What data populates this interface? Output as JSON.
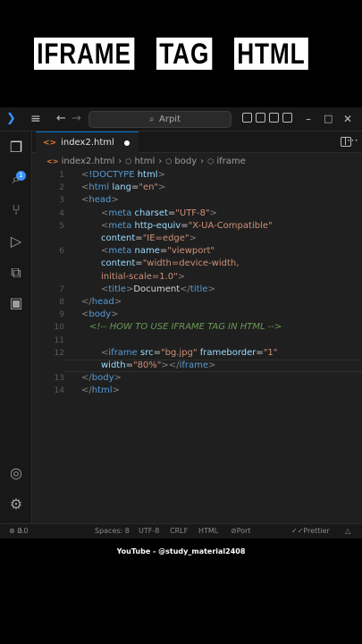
{
  "headline": {
    "words": [
      "IFRAME",
      "TAG",
      "HTML"
    ]
  },
  "titlebar": {
    "search_text": "Arpit"
  },
  "tab": {
    "label": "index2.html"
  },
  "breadcrumb": [
    "index2.html",
    "html",
    "body",
    "iframe"
  ],
  "code": {
    "lines": [
      {
        "n": "1",
        "segs": [
          [
            "b",
            "<"
          ],
          [
            "t",
            "!DOCTYPE"
          ],
          [
            "x",
            " "
          ],
          [
            "a",
            "html"
          ],
          [
            "b",
            ">"
          ]
        ]
      },
      {
        "n": "2",
        "segs": [
          [
            "b",
            "<"
          ],
          [
            "t",
            "html"
          ],
          [
            "x",
            " "
          ],
          [
            "a",
            "lang"
          ],
          [
            "x",
            "="
          ],
          [
            "s",
            "\"en\""
          ],
          [
            "b",
            ">"
          ]
        ]
      },
      {
        "n": "3",
        "segs": [
          [
            "b",
            "<"
          ],
          [
            "t",
            "head"
          ],
          [
            "b",
            ">"
          ]
        ]
      },
      {
        "n": "4",
        "segs": [
          [
            "b",
            "<"
          ],
          [
            "t",
            "meta"
          ],
          [
            "x",
            " "
          ],
          [
            "a",
            "charset"
          ],
          [
            "x",
            "="
          ],
          [
            "s",
            "\"UTF-8\""
          ],
          [
            "b",
            ">"
          ]
        ]
      },
      {
        "n": "5",
        "segs": [
          [
            "b",
            "<"
          ],
          [
            "t",
            "meta"
          ],
          [
            "x",
            " "
          ],
          [
            "a",
            "http-equiv"
          ],
          [
            "x",
            "="
          ],
          [
            "s",
            "\"X-UA-Compatible\""
          ]
        ]
      },
      {
        "n": "",
        "segs": [
          [
            "a",
            "content"
          ],
          [
            "x",
            "="
          ],
          [
            "s",
            "\"IE=edge\""
          ],
          [
            "b",
            ">"
          ]
        ]
      },
      {
        "n": "6",
        "segs": [
          [
            "b",
            "<"
          ],
          [
            "t",
            "meta"
          ],
          [
            "x",
            " "
          ],
          [
            "a",
            "name"
          ],
          [
            "x",
            "="
          ],
          [
            "s",
            "\"viewport\""
          ]
        ]
      },
      {
        "n": "",
        "segs": [
          [
            "a",
            "content"
          ],
          [
            "x",
            "="
          ],
          [
            "s",
            "\"width=device-width,"
          ]
        ]
      },
      {
        "n": "",
        "segs": [
          [
            "s",
            "initial-scale=1.0\""
          ],
          [
            "b",
            ">"
          ]
        ]
      },
      {
        "n": "7",
        "segs": [
          [
            "b",
            "<"
          ],
          [
            "t",
            "title"
          ],
          [
            "b",
            ">"
          ],
          [
            "x",
            "Document"
          ],
          [
            "b",
            "</"
          ],
          [
            "t",
            "title"
          ],
          [
            "b",
            ">"
          ]
        ]
      },
      {
        "n": "8",
        "segs": [
          [
            "b",
            "</"
          ],
          [
            "t",
            "head"
          ],
          [
            "b",
            ">"
          ]
        ]
      },
      {
        "n": "9",
        "segs": [
          [
            "b",
            "<"
          ],
          [
            "t",
            "body"
          ],
          [
            "b",
            ">"
          ]
        ]
      },
      {
        "n": "10",
        "segs": [
          [
            "c",
            "<!-- HOW TO USE IFRAME TAG IN HTML -->"
          ]
        ]
      },
      {
        "n": "11",
        "segs": []
      },
      {
        "n": "12",
        "segs": [
          [
            "b",
            "<"
          ],
          [
            "t",
            "iframe"
          ],
          [
            "x",
            " "
          ],
          [
            "a",
            "src"
          ],
          [
            "x",
            "="
          ],
          [
            "s",
            "\"bg.jpg\""
          ],
          [
            "x",
            " "
          ],
          [
            "a",
            "frameborder"
          ],
          [
            "x",
            "="
          ],
          [
            "s",
            "\"1\""
          ]
        ]
      },
      {
        "n": "",
        "segs": [
          [
            "a",
            "width"
          ],
          [
            "x",
            "="
          ],
          [
            "s",
            "\"80%\""
          ],
          [
            "b",
            ">"
          ],
          [
            "b",
            "</"
          ],
          [
            "t",
            "iframe"
          ],
          [
            "b",
            ">"
          ]
        ]
      },
      {
        "n": "13",
        "segs": [
          [
            "b",
            "</"
          ],
          [
            "t",
            "body"
          ],
          [
            "b",
            ">"
          ]
        ]
      },
      {
        "n": "14",
        "segs": [
          [
            "b",
            "</"
          ],
          [
            "t",
            "html"
          ],
          [
            "b",
            ">"
          ]
        ]
      }
    ]
  },
  "status": {
    "problems": "0",
    "warnings": "0",
    "spaces": "Spaces: 8",
    "encoding": "UTF-8",
    "eol": "CRLF",
    "language": "HTML",
    "port": "Port : 5500",
    "prettier": "Prettier"
  },
  "footer": {
    "text": "YouTube - @study_material2408"
  }
}
